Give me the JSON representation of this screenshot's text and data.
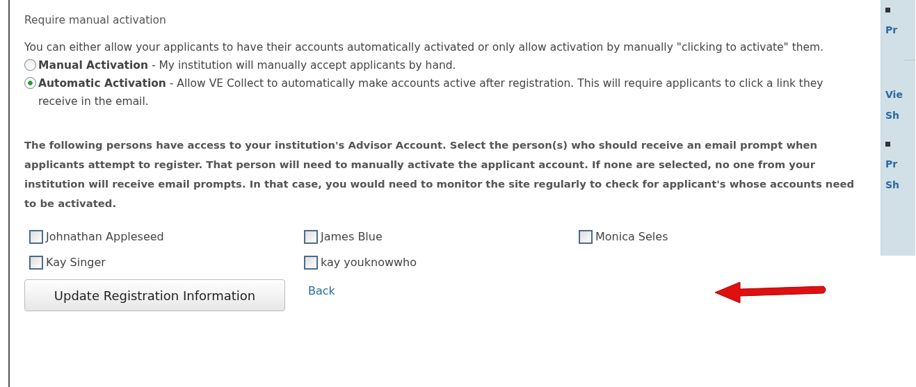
{
  "heading": "Require manual activation",
  "intro": "You can either allow your applicants to have their accounts automatically activated or only allow activation by manually \"clicking to activate\" them.",
  "activation_options": [
    {
      "text": "**Manual Activation** - My institution will manually accept applicants by hand.",
      "selected": false
    },
    {
      "text": "**Automatic Activation** - Allow VE Collect to automatically make accounts active after registration. This will require applicants to click a link they receive in the email.",
      "selected": true
    }
  ],
  "notice": "The following persons have access to your institution's Advisor Account. Select the person(s) who should receive an email prompt when applicants attempt to register. That person will need to manually activate the applicant account. If none are selected, no one from your institution will receive email prompts. In that case, you would need to monitor the site regularly to check for applicant's whose accounts need to be activated.",
  "persons": [
    {
      "name": "Johnathan Appleseed",
      "checked": false
    },
    {
      "name": "James Blue",
      "checked": false
    },
    {
      "name": "Monica Seles",
      "checked": false
    },
    {
      "name": "Kay Singer",
      "checked": false
    },
    {
      "name": "kay youknowwho",
      "checked": false
    }
  ],
  "submit_button": "Update Registration Information",
  "back_link": "Back",
  "sidebar": {
    "sections": [
      {
        "bullet": true,
        "lines": [
          "Pr"
        ]
      },
      {
        "bullet": false,
        "lines": [
          "Vie",
          "Sh"
        ]
      },
      {
        "bullet": true,
        "lines": [
          "Pr",
          "Sh"
        ]
      }
    ]
  }
}
